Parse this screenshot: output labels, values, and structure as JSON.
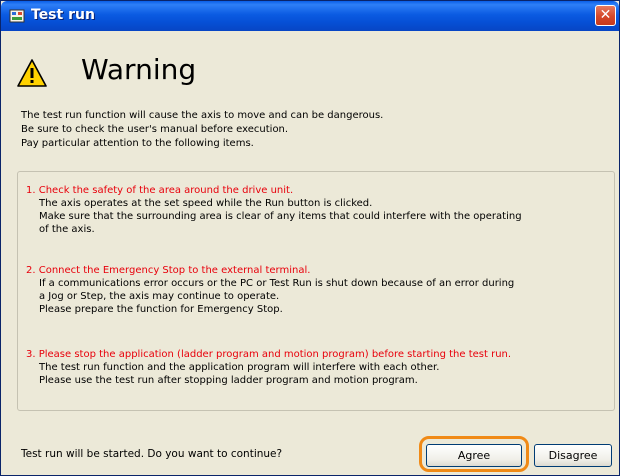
{
  "window": {
    "title": "Test run",
    "close_glyph": "✕",
    "icons": {
      "app": "app-icon",
      "close": "close-icon",
      "warning": "warning-icon"
    },
    "colors": {
      "titlebar": "#0b5be2",
      "warning_items": "#e8000b",
      "highlight": "#f08a16"
    }
  },
  "header": {
    "title": "Warning"
  },
  "intro": {
    "lines": [
      "The test run function will cause the axis to move and can be dangerous.",
      "Be sure to check the user's manual before execution.",
      "Pay particular attention to the following items."
    ]
  },
  "items": [
    {
      "heading": "1. Check the safety of the area around the drive unit.",
      "lines": [
        "The axis operates at the set speed while the Run button is clicked.",
        "Make sure that the surrounding area is clear of any items that could interfere with the operating",
        "of the axis."
      ]
    },
    {
      "heading": "2. Connect the Emergency Stop to the external terminal.",
      "lines": [
        "If a communications error occurs or the PC or Test Run is shut down because of an error during",
        "a Jog or Step, the axis may continue to operate.",
        "Please prepare the function for Emergency Stop."
      ]
    },
    {
      "heading": "3. Please stop the application (ladder program and motion program) before starting the test run.",
      "lines": [
        "The test run function and the application program will interfere with each other.",
        "Please use the test run after stopping ladder program and motion program."
      ]
    }
  ],
  "footer": {
    "prompt": "Test run will be started. Do you want to continue?",
    "agree_label": "Agree",
    "disagree_label": "Disagree"
  }
}
